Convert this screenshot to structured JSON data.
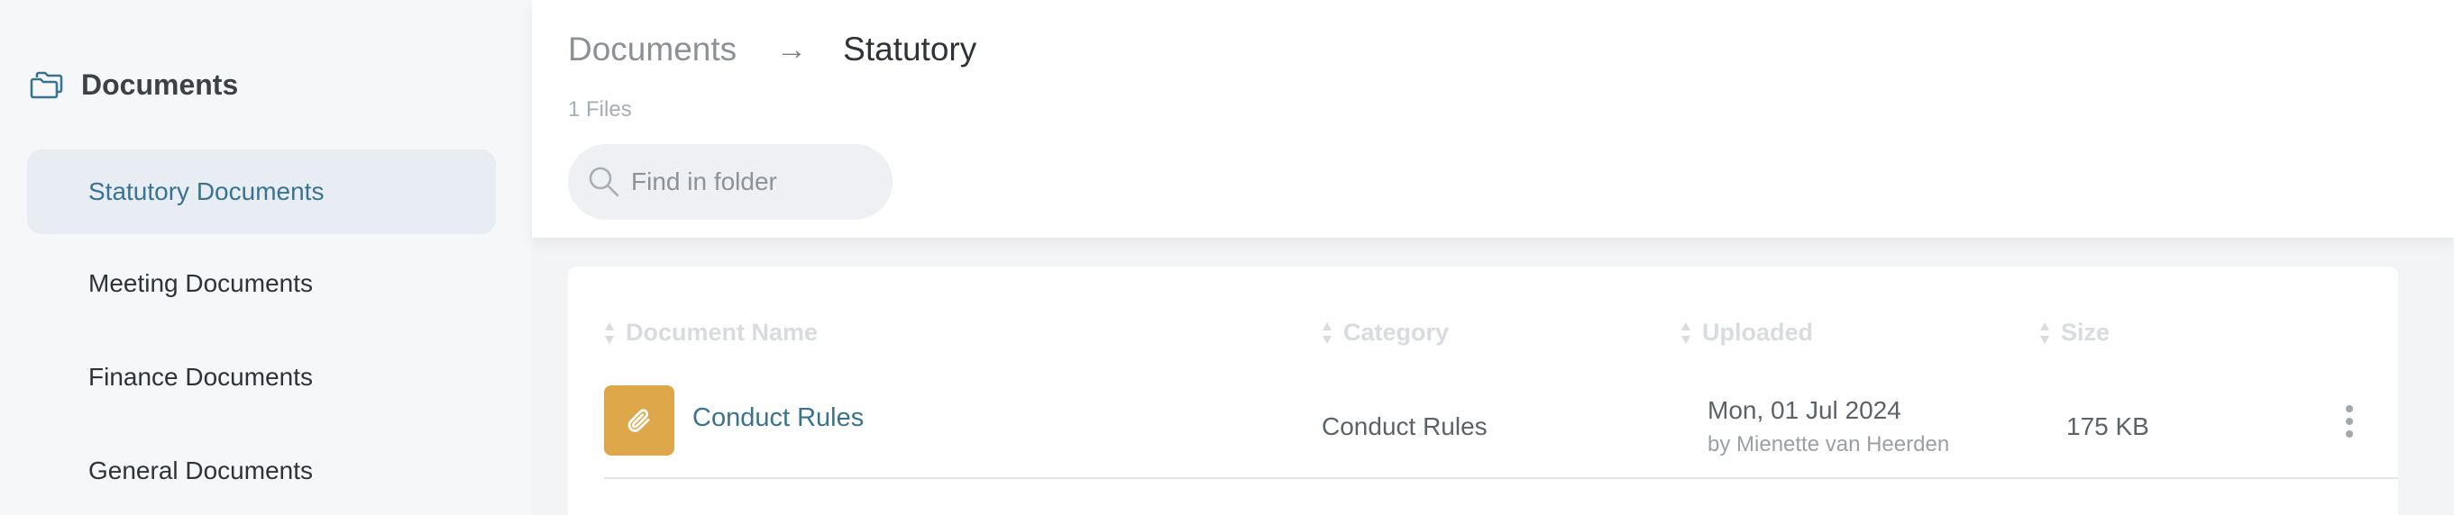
{
  "sidebar": {
    "title": "Documents",
    "icon": "folders-icon",
    "items": [
      {
        "label": "Statutory Documents",
        "active": true
      },
      {
        "label": "Meeting Documents",
        "active": false
      },
      {
        "label": "Finance Documents",
        "active": false
      },
      {
        "label": "General Documents",
        "active": false
      }
    ]
  },
  "header": {
    "breadcrumb": {
      "root": "Documents",
      "separator": "→",
      "current": "Statutory"
    },
    "file_count": "1 Files",
    "search": {
      "placeholder": "Find in folder",
      "value": ""
    }
  },
  "table": {
    "columns": [
      "Document Name",
      "Category",
      "Uploaded",
      "Size"
    ],
    "rows": [
      {
        "name": "Conduct Rules",
        "icon": "paperclip-icon",
        "category": "Conduct Rules",
        "uploaded_date": "Mon, 01 Jul 2024",
        "uploaded_by": "by Mienette van Heerden",
        "size": "175 KB"
      }
    ]
  },
  "colors": {
    "accent": "#3a7390",
    "active_bg": "#e7edf3",
    "file_icon_bg": "#dea84a"
  }
}
